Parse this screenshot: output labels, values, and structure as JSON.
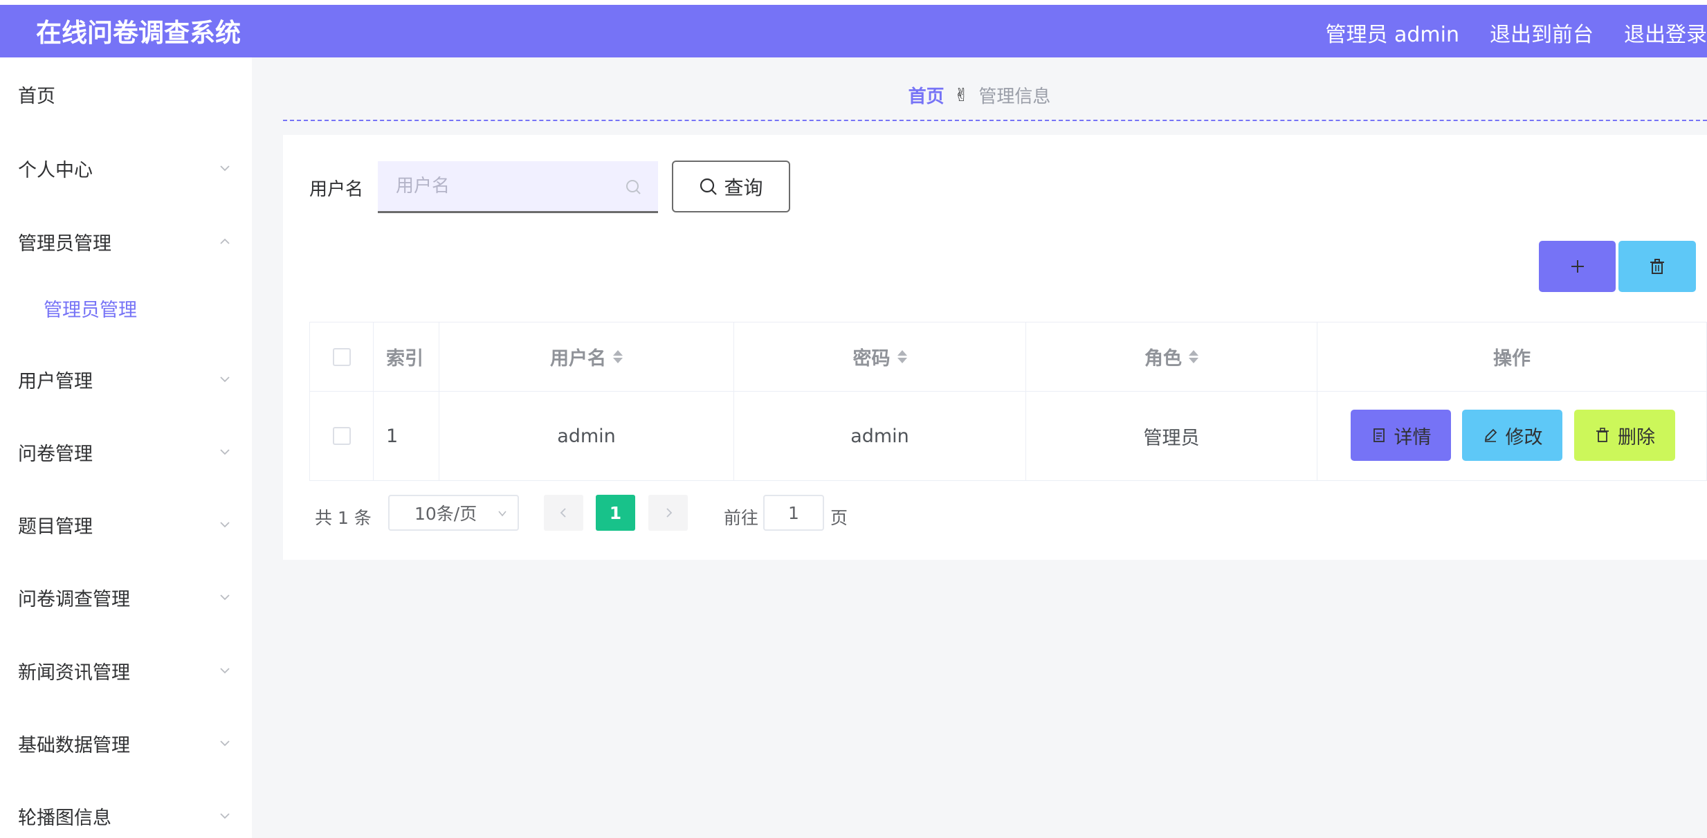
{
  "header": {
    "title": "在线问卷调查系统",
    "user_label": "管理员 admin",
    "back_to_front": "退出到前台",
    "logout": "退出登录",
    "accent_color": "#7673f6"
  },
  "sidebar": {
    "items": [
      {
        "label": "首页"
      },
      {
        "label": "个人中心",
        "chevron": "chevron-down-icon"
      },
      {
        "label": "管理员管理",
        "chevron": "chevron-up-icon"
      },
      {
        "label": "管理员管理",
        "submenu": true,
        "active": true
      },
      {
        "label": "用户管理",
        "chevron": "chevron-down-icon"
      },
      {
        "label": "问卷管理",
        "chevron": "chevron-down-icon"
      },
      {
        "label": "题目管理",
        "chevron": "chevron-down-icon"
      },
      {
        "label": "问卷调查管理",
        "chevron": "chevron-down-icon"
      },
      {
        "label": "新闻资讯管理",
        "chevron": "chevron-down-icon"
      },
      {
        "label": "基础数据管理",
        "chevron": "chevron-down-icon"
      },
      {
        "label": "轮播图信息",
        "chevron": "chevron-down-icon"
      }
    ]
  },
  "breadcrumb": {
    "home": "首页",
    "separator_icon": "hand-icon",
    "current": "管理信息"
  },
  "search": {
    "label": "用户名",
    "placeholder": "用户名",
    "value": "",
    "button_label": "查询"
  },
  "toolbar": {
    "add_icon": "plus-icon",
    "delete_icon": "trash-icon"
  },
  "table": {
    "columns": [
      "索引",
      "用户名",
      "密码",
      "角色",
      "操作"
    ],
    "rows": [
      {
        "index": "1",
        "username": "admin",
        "password": "admin",
        "role": "管理员"
      }
    ],
    "actions": {
      "detail": "详情",
      "edit": "修改",
      "delete": "删除"
    }
  },
  "pagination": {
    "total": "共 1 条",
    "page_size": "10条/页",
    "current_page": "1",
    "goto_prefix": "前往",
    "goto_value": "1",
    "goto_suffix": "页"
  }
}
